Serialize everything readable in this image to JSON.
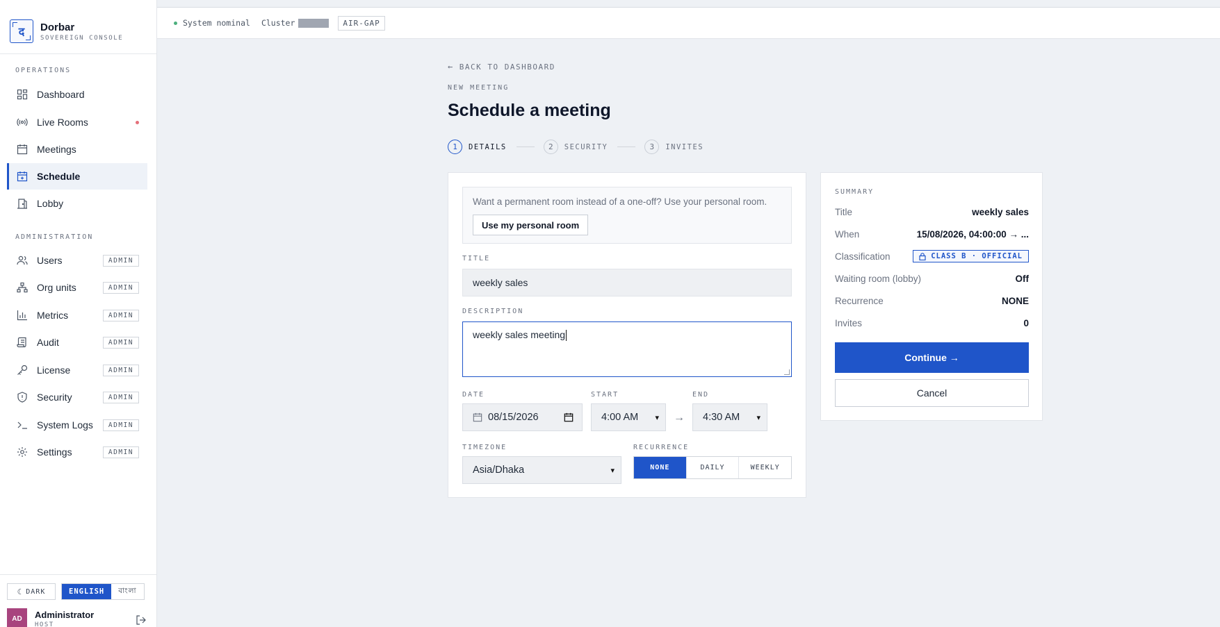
{
  "brand": {
    "name": "Dorbar",
    "subtitle": "SOVEREIGN CONSOLE",
    "logo_glyph": "द"
  },
  "sidebar": {
    "operations_label": "OPERATIONS",
    "administration_label": "ADMINISTRATION",
    "operations": [
      {
        "label": "Dashboard",
        "icon": "dashboard-icon"
      },
      {
        "label": "Live Rooms",
        "icon": "broadcast-icon"
      },
      {
        "label": "Meetings",
        "icon": "calendar-icon"
      },
      {
        "label": "Schedule",
        "icon": "calendar-plus-icon",
        "active": true
      },
      {
        "label": "Lobby",
        "icon": "door-icon"
      }
    ],
    "administration": [
      {
        "label": "Users",
        "icon": "users-icon",
        "badge": "ADMIN"
      },
      {
        "label": "Org units",
        "icon": "org-icon",
        "badge": "ADMIN"
      },
      {
        "label": "Metrics",
        "icon": "chart-icon",
        "badge": "ADMIN"
      },
      {
        "label": "Audit",
        "icon": "scroll-icon",
        "badge": "ADMIN"
      },
      {
        "label": "License",
        "icon": "key-icon",
        "badge": "ADMIN"
      },
      {
        "label": "Security",
        "icon": "shield-icon",
        "badge": "ADMIN"
      },
      {
        "label": "System Logs",
        "icon": "terminal-icon",
        "badge": "ADMIN"
      },
      {
        "label": "Settings",
        "icon": "gear-icon",
        "badge": "ADMIN"
      }
    ],
    "theme_toggle": "DARK",
    "languages": [
      "ENGLISH",
      "বাংলা"
    ],
    "user": {
      "initials": "AD",
      "name": "Administrator",
      "role": "HOST"
    }
  },
  "topbar": {
    "status": "System nominal",
    "cluster_label": "Cluster",
    "airgap": "AIR-GAP"
  },
  "page": {
    "back_link": "BACK TO DASHBOARD",
    "eyebrow": "NEW MEETING",
    "title": "Schedule a meeting",
    "steps": [
      {
        "num": "1",
        "label": "DETAILS",
        "active": true
      },
      {
        "num": "2",
        "label": "SECURITY"
      },
      {
        "num": "3",
        "label": "INVITES"
      }
    ]
  },
  "form": {
    "personal_prompt": "Want a permanent room instead of a one-off? Use your personal room.",
    "personal_button": "Use my personal room",
    "title_label": "TITLE",
    "title_value": "weekly sales",
    "description_label": "DESCRIPTION",
    "description_value": "weekly sales meeting",
    "date_label": "DATE",
    "date_value": "08/15/2026",
    "start_label": "START",
    "start_value": "4:00 AM",
    "end_label": "END",
    "end_value": "4:30 AM",
    "timezone_label": "TIMEZONE",
    "timezone_value": "Asia/Dhaka",
    "recurrence_label": "RECURRENCE",
    "recurrence_options": [
      "NONE",
      "DAILY",
      "WEEKLY"
    ],
    "recurrence_selected": "NONE"
  },
  "summary": {
    "label": "SUMMARY",
    "rows": {
      "title": {
        "key": "Title",
        "value": "weekly sales"
      },
      "when": {
        "key": "When",
        "value": "15/08/2026, 04:00:00 → ..."
      },
      "classification": {
        "key": "Classification",
        "value": "CLASS B · OFFICIAL"
      },
      "waiting": {
        "key": "Waiting room (lobby)",
        "value": "Off"
      },
      "recurrence": {
        "key": "Recurrence",
        "value": "NONE"
      },
      "invites": {
        "key": "Invites",
        "value": "0"
      }
    },
    "continue_button": "Continue →",
    "cancel_button": "Cancel"
  },
  "colors": {
    "accent": "#1f55c9",
    "status_ok": "#4caf7d",
    "live_dot": "#e5707a",
    "avatar": "#a8447e"
  }
}
